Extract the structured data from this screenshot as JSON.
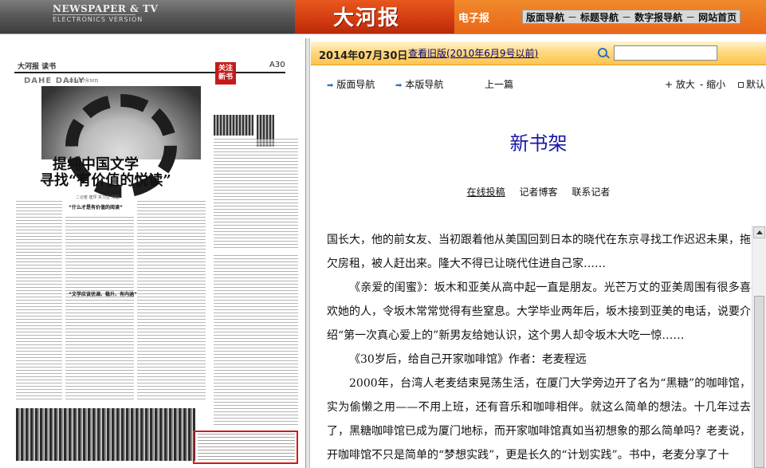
{
  "banner": {
    "left_title": "NEWSPAPER & TV",
    "left_subtitle": "ELECTRONICS VERSION",
    "logo": "大河报",
    "edition_label": "电子报",
    "nav": [
      "版面导航",
      "标题导航",
      "数字报导航",
      "网站首页"
    ]
  },
  "newspaper_page": {
    "brand": "大河报",
    "section": "读书",
    "dahe": "DAHE DAILY",
    "date": "2014年7月30日",
    "page_no": "A30",
    "section_tag": "关注新书",
    "headline_line1": "提纯中国文学",
    "headline_line2": "寻找“有价值的悦读”",
    "byline": "二记者 崔坪 实习生 常磊",
    "subheads": [
      "“什么才是有价值的阅读”",
      "“文学应该优调、稳升、有内涵”"
    ]
  },
  "datebar": {
    "date": "2014年07月30日",
    "old_version_link": "查看旧版(2010年6月9号以前)",
    "search_placeholder": ""
  },
  "toolbar": {
    "layout_nav": "版面导航",
    "this_layout_nav": "本版导航",
    "prev": "上一篇",
    "zoom_in": "放大",
    "zoom_out": "缩小",
    "default": "默认"
  },
  "article": {
    "title": "新书架",
    "links": [
      "在线投稿",
      "记者博客",
      "联系记者"
    ],
    "paragraphs": [
      "国长大，他的前女友、当初跟着他从美国回到日本的晓代在东京寻找工作迟迟未果，拖欠房租，被人赶出来。隆大不得已让晓代住进自己家……",
      "《亲爱的闺蜜》：坂木和亚美从高中起一直是朋友。光芒万丈的亚美周围有很多喜欢她的人，令坂木常常觉得有些窒息。大学毕业两年后，坂木接到亚美的电话，说要介绍“第一次真心爱上的”新男友给她认识，这个男人却令坂木大吃一惊……",
      "《30岁后，给自己开家咖啡馆》作者：老麦程远",
      "2000年，台湾人老麦结束晃荡生活，在厦门大学旁边开了名为“黑糖”的咖啡馆，实为偷懒之用——不用上班，还有音乐和咖啡相伴。就这么简单的想法。十几年过去了，黑糖咖啡馆已成为厦门地标，而开家咖啡馆真如当初想象的那么简单吗？老麦说，开咖啡馆不只是简单的“梦想实践”，更是长久的“计划实践”。书中，老麦分享了十"
    ]
  }
}
